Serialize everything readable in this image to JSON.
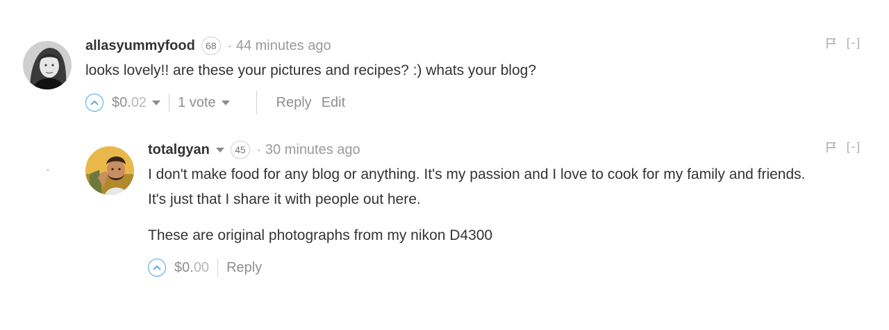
{
  "comments": [
    {
      "author": "allasyummyfood",
      "reputation": "68",
      "separator": "·",
      "time": "44 minutes ago",
      "text": [
        "looks lovely!! are these your pictures and recipes? :) whats your blog?"
      ],
      "payout_main": "$0.",
      "payout_cents": "02",
      "votes": "1 vote",
      "actions": [
        "Reply",
        "Edit"
      ],
      "collapse": "[-]"
    },
    {
      "author": "totalgyan",
      "reputation": "45",
      "separator": "·",
      "time": "30 minutes ago",
      "text": [
        "I don't make food for any blog or anything. It's my passion and I love to cook for my family and friends.",
        "It's just that I share it with people out here.",
        "These are original photographs from my nikon D4300"
      ],
      "payout_main": "$0.",
      "payout_cents": "00",
      "actions": [
        "Reply"
      ],
      "collapse": "[-]"
    }
  ],
  "icons": {
    "upvote": "chevron-up-circle-icon",
    "flag": "flag-icon",
    "caret": "caret-down-icon"
  },
  "colors": {
    "upvote_accent": "#4aa3df",
    "muted_text": "#8f8f8f",
    "body_text": "#333333"
  }
}
